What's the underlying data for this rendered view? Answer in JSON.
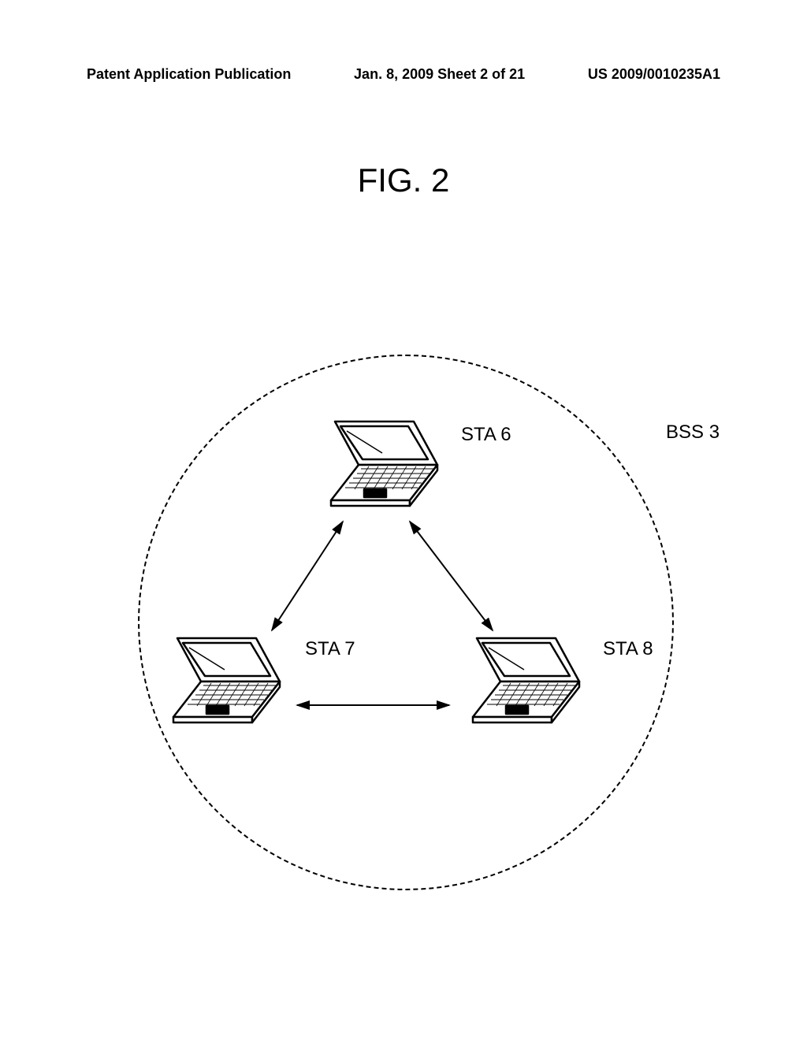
{
  "header": {
    "left": "Patent Application Publication",
    "center": "Jan. 8, 2009  Sheet 2 of 21",
    "right": "US 2009/0010235A1"
  },
  "figure": {
    "title": "FIG. 2"
  },
  "diagram": {
    "bss_label": "BSS 3",
    "stations": {
      "sta6": "STA 6",
      "sta7": "STA 7",
      "sta8": "STA 8"
    }
  }
}
